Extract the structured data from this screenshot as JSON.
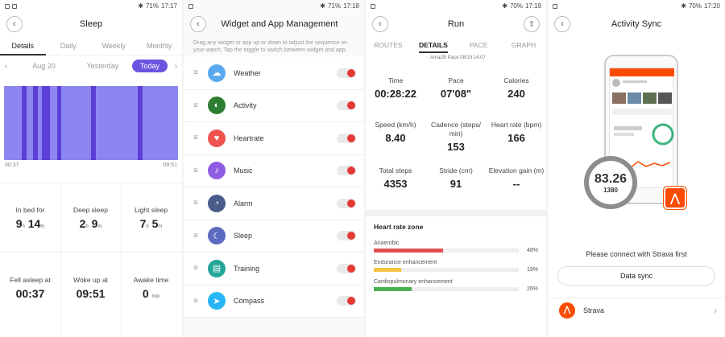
{
  "sleep_screen": {
    "status": {
      "icons": "✱ ⊕ ▮",
      "battery": "71%",
      "time": "17:17"
    },
    "title": "Sleep",
    "tabs": [
      "Details",
      "Daily",
      "Weekly",
      "Monthly"
    ],
    "dates": {
      "prev": "Aug 20",
      "yesterday": "Yesterday",
      "today": "Today"
    },
    "chart_times": {
      "start": "00:37",
      "end": "09:51"
    },
    "stats": [
      {
        "label": "In bed for",
        "h": "9",
        "m": "14"
      },
      {
        "label": "Deep sleep",
        "h": "2",
        "m": "9"
      },
      {
        "label": "Light sleep",
        "h": "7",
        "m": "5"
      },
      {
        "label": "Fell asleep at",
        "value": "00:37"
      },
      {
        "label": "Woke up at",
        "value": "09:51"
      },
      {
        "label": "Awake time",
        "value": "0",
        "unit": "min"
      }
    ],
    "units": {
      "h": "h",
      "m": "m"
    }
  },
  "widget_screen": {
    "status": {
      "battery": "71%",
      "time": "17:18"
    },
    "title": "Widget and App Management",
    "hint": "Drag any widget or app up or down to adjust the sequence on your watch. Tap the toggle to switch between widget and app.",
    "items": [
      {
        "label": "Weather",
        "icon": "weather-icon",
        "color": "#5aa9f0",
        "glyph": "☁"
      },
      {
        "label": "Activity",
        "icon": "activity-icon",
        "color": "#2e7d32",
        "glyph": "◐"
      },
      {
        "label": "Heartrate",
        "icon": "heartrate-icon",
        "color": "#ef5350",
        "glyph": "♥"
      },
      {
        "label": "Music",
        "icon": "music-icon",
        "color": "#8e5ce0",
        "glyph": "♪"
      },
      {
        "label": "Alarm",
        "icon": "alarm-icon",
        "color": "#4a5a8a",
        "glyph": "◔"
      },
      {
        "label": "Sleep",
        "icon": "sleep-icon",
        "color": "#5c6bc0",
        "glyph": "☾"
      },
      {
        "label": "Training",
        "icon": "training-icon",
        "color": "#26a69a",
        "glyph": "▤"
      },
      {
        "label": "Compass",
        "icon": "compass-icon",
        "color": "#29b6f6",
        "glyph": "➤"
      }
    ]
  },
  "run_screen": {
    "status": {
      "battery": "70%",
      "time": "17:19"
    },
    "title": "Run",
    "tabs": [
      "ROUTES",
      "DETAILS",
      "PACE",
      "GRAPH"
    ],
    "device": "Amazfit Pace  08/19 14:07",
    "stats": [
      {
        "label": "Time",
        "value": "00:28:22"
      },
      {
        "label": "Pace",
        "value": "07'08\""
      },
      {
        "label": "Calories",
        "value": "240"
      },
      {
        "label": "Speed (km/h)",
        "value": "8.40"
      },
      {
        "label": "Cadence (steps/ min)",
        "value": "153"
      },
      {
        "label": "Heart rate (bpm)",
        "value": "166"
      },
      {
        "label": "Total steps",
        "value": "4353"
      },
      {
        "label": "Stride (cm)",
        "value": "91"
      },
      {
        "label": "Elevation gain (m)",
        "value": "--"
      }
    ],
    "heart_rate_zone": {
      "title": "Heart rate zone",
      "zones": [
        {
          "label": "Anaerobic",
          "percent": "48%",
          "fraction": 0.48,
          "color": "#e05050"
        },
        {
          "label": "Endurance enhancement",
          "percent": "19%",
          "fraction": 0.19,
          "color": "#f5c242"
        },
        {
          "label": "Cardiopulmonary enhancement",
          "percent": "26%",
          "fraction": 0.26,
          "color": "#4caf50"
        }
      ]
    }
  },
  "sync_screen": {
    "status": {
      "battery": "70%",
      "time": "17:20"
    },
    "title": "Activity Sync",
    "watch": {
      "value": "83.26",
      "sub": "1380"
    },
    "message": "Please connect with Strava first",
    "button": "Data sync",
    "service": "Strava"
  }
}
